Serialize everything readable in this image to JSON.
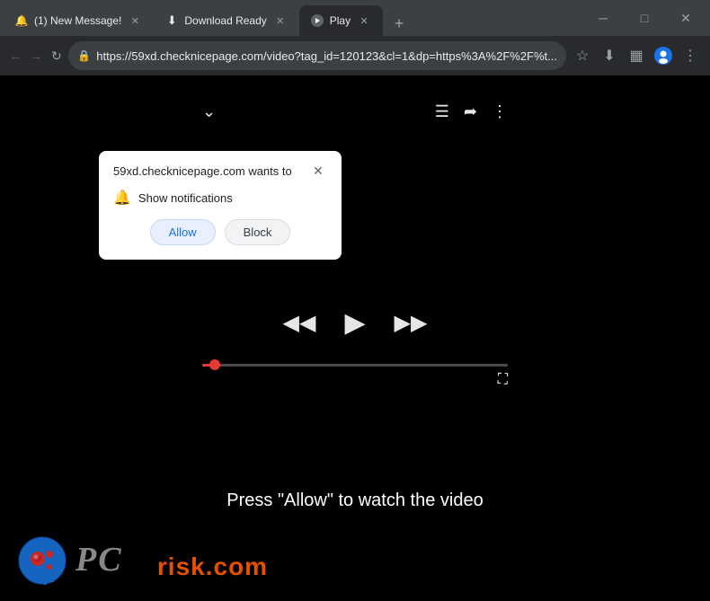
{
  "browser": {
    "tabs": [
      {
        "id": "tab-message",
        "title": "(1) New Message!",
        "favicon": "🔔",
        "active": false
      },
      {
        "id": "tab-download",
        "title": "Download Ready",
        "favicon": "⬇",
        "active": false
      },
      {
        "id": "tab-play",
        "title": "Play",
        "favicon": "▶",
        "active": true
      }
    ],
    "address": "https://59xd.checknicepage.com/video?tag_id=120123&cl=1&dp=https%3A%2F%2F%t...",
    "window_controls": {
      "minimize": "─",
      "maximize": "□",
      "close": "✕"
    }
  },
  "popup": {
    "title": "59xd.checknicepage.com wants to",
    "close_label": "✕",
    "permission_label": "Show notifications",
    "allow_label": "Allow",
    "block_label": "Block"
  },
  "video_player": {
    "prompt_text": "Press \"Allow\" to watch the video"
  },
  "watermark": {
    "text_gray": "PC",
    "text_orange": "risk.com"
  }
}
